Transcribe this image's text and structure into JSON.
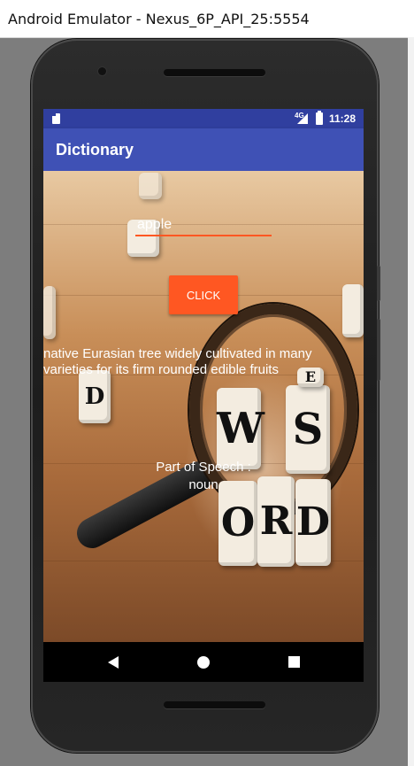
{
  "window": {
    "title": "Android Emulator - Nexus_6P_API_25:5554"
  },
  "statusbar": {
    "network": "4G",
    "time": "11:28"
  },
  "app": {
    "title": "Dictionary"
  },
  "search": {
    "value": "apple"
  },
  "button": {
    "label": "CLICK"
  },
  "result": {
    "definition": "native Eurasian tree widely cultivated in many varieties for its firm rounded edible fruits",
    "pos_label": "Part of Speech :",
    "pos_value": "noun"
  },
  "background": {
    "cube_letters": [
      "W",
      "S",
      "O",
      "R",
      "D",
      "E",
      "D"
    ]
  },
  "colors": {
    "primary": "#3f51b5",
    "primary_dark": "#303f9f",
    "accent": "#ff5722"
  },
  "navigation": {
    "icons": [
      "back-icon",
      "home-icon",
      "recents-icon"
    ]
  }
}
